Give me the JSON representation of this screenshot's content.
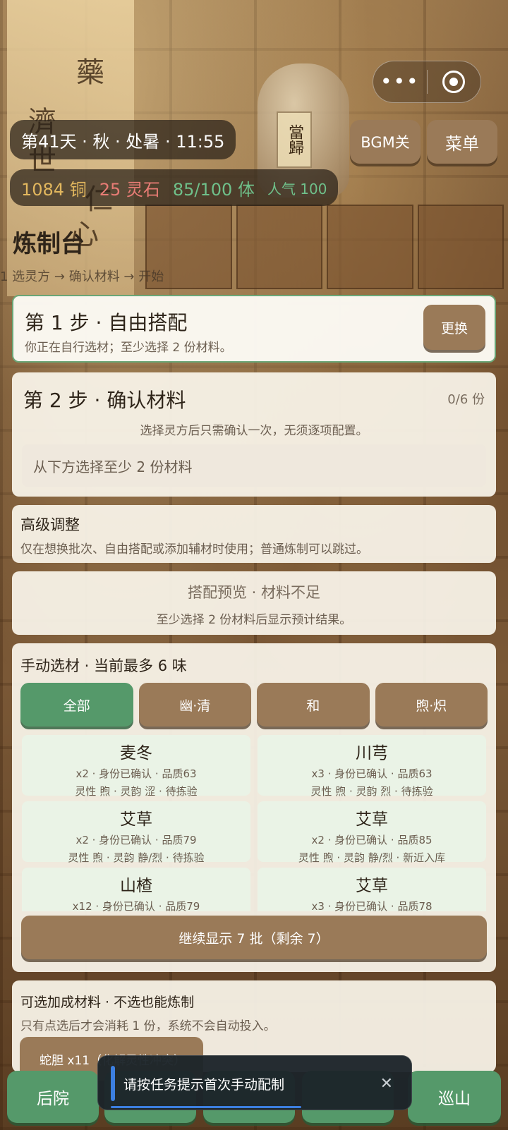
{
  "background": {
    "scroll_glyphs": [
      "藥",
      "濟",
      "世",
      "仁",
      "心"
    ],
    "jar_label": "當歸"
  },
  "capsule": {
    "more_icon": "more-dots-icon",
    "close_icon": "target-icon"
  },
  "hud": {
    "date": "第41天 · 秋 · 处暑 · 11:55",
    "copper": "1084 铜",
    "spirit_stone": "25 灵石",
    "stamina": "85/100 体",
    "fame": "人气 100",
    "bgm_label": "BGM关",
    "menu_label": "菜单"
  },
  "colors": {
    "copper": "#e2b75e",
    "spirit_stone": "#e87c75",
    "stamina": "#6fc08a",
    "accent_green": "#55996a",
    "button_brown": "#9a7a58"
  },
  "page_title": "炼制台",
  "breadcrumb": "1 选灵方 → 确认材料 → 开始",
  "step1": {
    "title": "第 1 步 · 自由搭配",
    "subtitle": "你正在自行选材；至少选择 2 份材料。",
    "swap_label": "更换"
  },
  "step2": {
    "title": "第 2 步 · 确认材料",
    "count": "0/6 份",
    "hint": "选择灵方后只需确认一次，无须逐项配置。",
    "placeholder": "从下方选择至少 2 份材料"
  },
  "advanced": {
    "title": "高级调整",
    "subtitle": "仅在想换批次、自由搭配或添加辅材时使用；普通炼制可以跳过。"
  },
  "preview": {
    "title": "搭配预览 · 材料不足",
    "subtitle": "至少选择 2 份材料后显示预计结果。"
  },
  "manual": {
    "title": "手动选材 · 当前最多 6 味",
    "tabs": [
      {
        "label": "全部",
        "active": true
      },
      {
        "label": "幽·清",
        "active": false
      },
      {
        "label": "和",
        "active": false
      },
      {
        "label": "煦·炽",
        "active": false
      }
    ],
    "herbs": [
      {
        "name": "麦冬",
        "line1": "x2 · 身份已确认 · 品质63",
        "line2": "灵性 煦 · 灵韵 涩 · 待拣验"
      },
      {
        "name": "川芎",
        "line1": "x3 · 身份已确认 · 品质63",
        "line2": "灵性 煦 · 灵韵 烈 · 待拣验"
      },
      {
        "name": "艾草",
        "line1": "x2 · 身份已确认 · 品质79",
        "line2": "灵性 煦 · 灵韵 静/烈 · 待拣验"
      },
      {
        "name": "艾草",
        "line1": "x2 · 身份已确认 · 品质85",
        "line2": "灵性 煦 · 灵韵 静/烈 · 新近入库"
      },
      {
        "name": "山楂",
        "line1": "x12 · 身份已确认 · 品质79",
        "line2": ""
      },
      {
        "name": "艾草",
        "line1": "x3 · 身份已确认 · 品质78",
        "line2": ""
      }
    ],
    "more_label": "继续显示 7 批（剩余 7）"
  },
  "addon": {
    "title": "可选加成材料 · 不选也能炼制",
    "subtitle": "只有点选后才会消耗 1 份，系统不会自动投入。",
    "item_label": "蛇胆 x11（化解灵性冲突）"
  },
  "bottom_nav": {
    "left_label": "后院",
    "right_label": "巡山"
  },
  "toast": {
    "message": "请按任务提示首次手动配制",
    "close_icon": "close-icon"
  }
}
